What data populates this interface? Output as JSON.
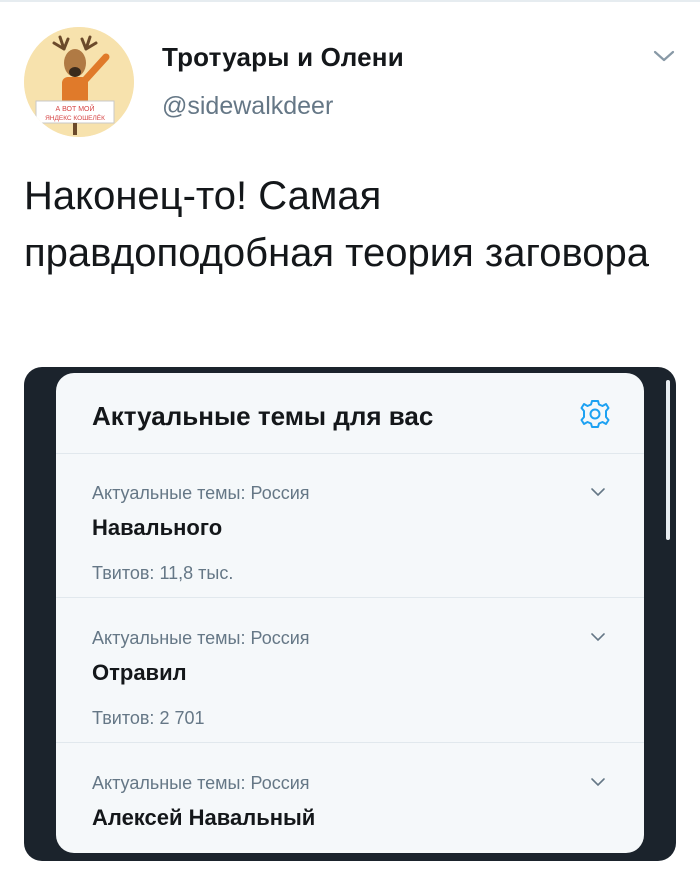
{
  "tweet": {
    "author_name": "Тротуары и Олени",
    "author_handle": "@sidewalkdeer",
    "text": "Наконец-то! Самая правдоподобная теория заговора"
  },
  "avatar": {
    "sign_line1": "А ВОТ МОЙ",
    "sign_line2": "ЯНДЕКС КОШЕЛЁК"
  },
  "embedded_screenshot": {
    "title": "Актуальные темы для вас",
    "trends": [
      {
        "context": "Актуальные темы: Россия",
        "name": "Навального",
        "count": "Твитов: 11,8 тыс."
      },
      {
        "context": "Актуальные темы: Россия",
        "name": "Отравил",
        "count": "Твитов: 2 701"
      },
      {
        "context": "Актуальные темы: Россия",
        "name": "Алексей Навальный",
        "count": ""
      }
    ]
  },
  "colors": {
    "accent": "#1da1f2",
    "secondary_text": "#657786",
    "card_background": "#f5f8fa",
    "frame_background": "#1b232c"
  }
}
